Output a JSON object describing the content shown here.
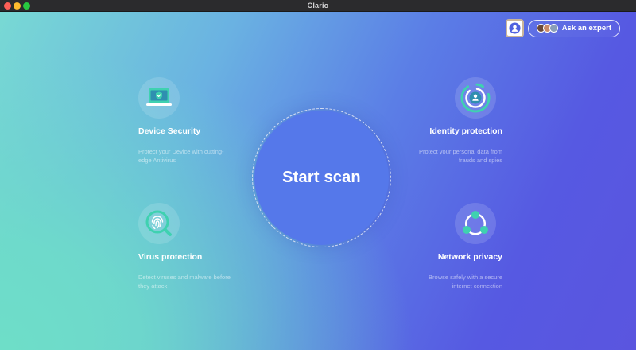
{
  "window": {
    "title": "Clario"
  },
  "header": {
    "expert_label": "Ask an expert"
  },
  "scan": {
    "label": "Start scan"
  },
  "features": {
    "device": {
      "title": "Device Security",
      "desc_line1": "Protect your Device with cutting-",
      "desc_line2": "edge Antivirus"
    },
    "identity": {
      "title": "Identity protection",
      "desc_line1": "Protect your personal data from",
      "desc_line2": "frauds and spies"
    },
    "virus": {
      "title": "Virus protection",
      "desc_line1": "Detect viruses and malware before",
      "desc_line2": "they attack"
    },
    "network": {
      "title": "Network privacy",
      "desc_line1": "Browse safely with a secure",
      "desc_line2": "internet connection"
    }
  },
  "colors": {
    "accent": "#5578ea",
    "icon_green": "#3fd1b0",
    "icon_dark": "#2f7fb0"
  },
  "icons": [
    "laptop-shield-icon",
    "identity-icon",
    "fingerprint-search-icon",
    "network-icon",
    "user-icon"
  ]
}
